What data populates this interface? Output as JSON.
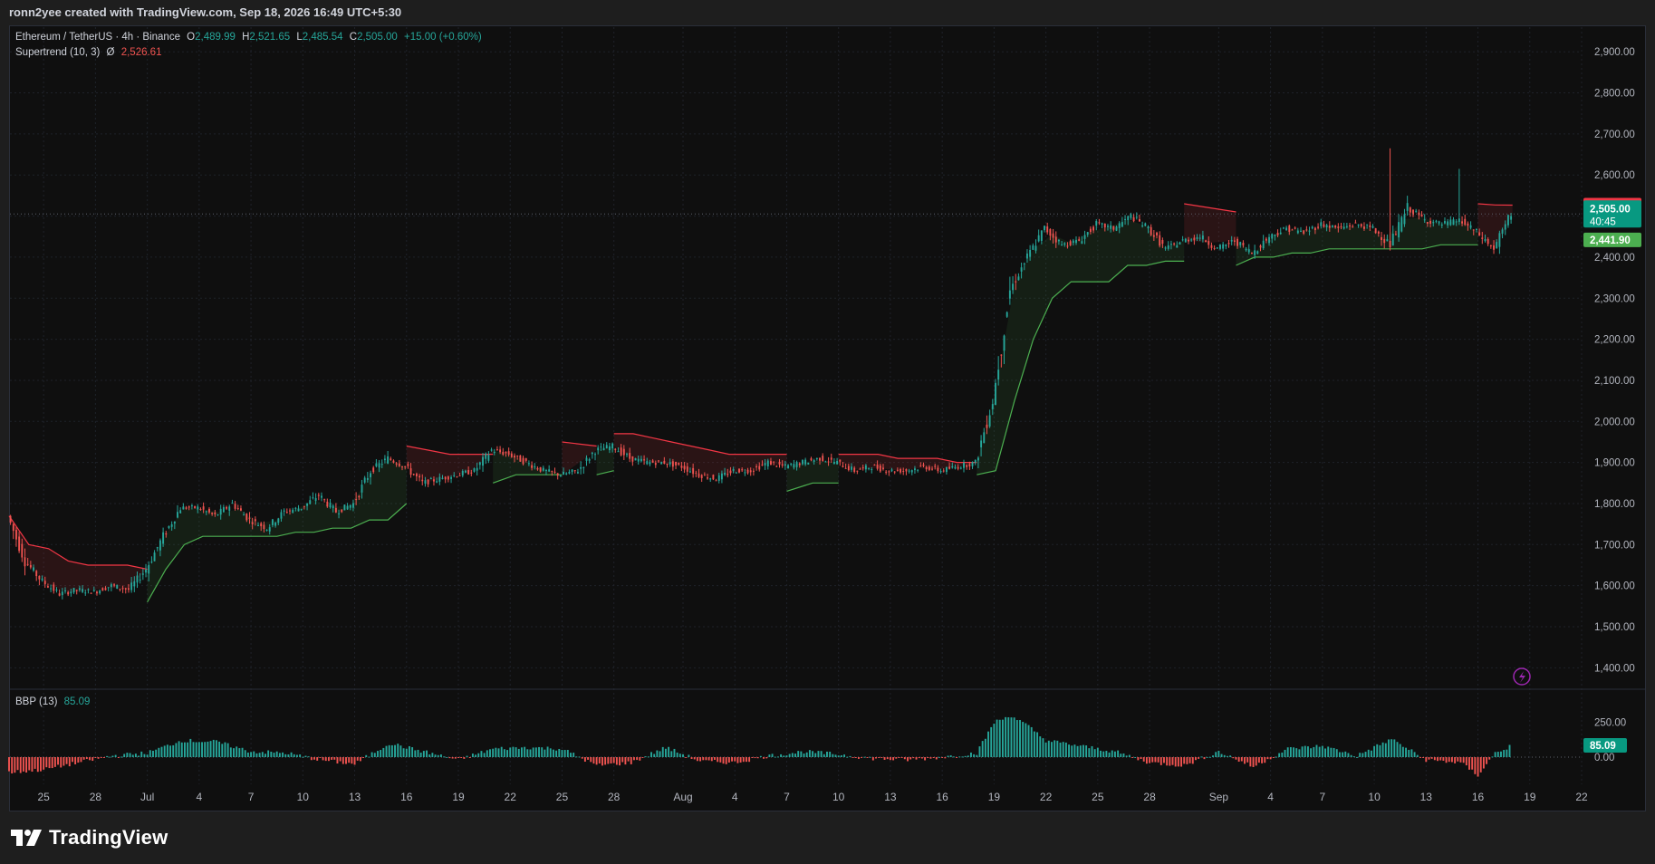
{
  "header": {
    "credit": "ronn2yee created with TradingView.com, Sep 18, 2026 16:49 UTC+5:30"
  },
  "legend": {
    "symbol": "Ethereum / TetherUS · 4h · Binance",
    "o_label": "O",
    "o_value": "2,489.99",
    "h_label": "H",
    "h_value": "2,521.65",
    "l_label": "L",
    "l_value": "2,485.54",
    "c_label": "C",
    "c_value": "2,505.00",
    "change": "+15.00 (+0.60%)",
    "indicator_name": "Supertrend (10, 3)",
    "indicator_sep": "Ø",
    "indicator_value": "2,526.61"
  },
  "bbp_legend": {
    "name": "BBP (13)",
    "value": "85.09"
  },
  "price_labels": {
    "supertrend": "2,526.61",
    "last": "2,505.00",
    "countdown": "40:45",
    "support": "2,441.90",
    "bbp_last": "85.09"
  },
  "brand": {
    "name": "TradingView"
  },
  "colors": {
    "up": "#26a69a",
    "down": "#ef5350",
    "up_line": "#4caf50",
    "down_line": "#f23645",
    "background": "#0f0f0f",
    "grid": "#1f2229",
    "text": "#b2b5be",
    "alert_icon": "#9c27b0"
  },
  "chart_data": [
    {
      "type": "candlestick",
      "title": "",
      "timeframe": "4h",
      "y_axis": {
        "ticks": [
          1400,
          1500,
          1600,
          1700,
          1800,
          1900,
          2000,
          2100,
          2200,
          2300,
          2400,
          2500,
          2600,
          2700,
          2800,
          2900
        ],
        "tick_labels": [
          "1,400.00",
          "1,500.00",
          "1,600.00",
          "1,700.00",
          "1,800.00",
          "1,900.00",
          "2,000.00",
          "2,100.00",
          "2,200.00",
          "2,300.00",
          "2,400.00",
          "2,500.00",
          "2,600.00",
          "2,700.00",
          "2,800.00",
          "2,900.00"
        ],
        "range": [
          1350,
          2960
        ]
      },
      "x_axis": {
        "tick_labels": [
          "25",
          "28",
          "Jul",
          "4",
          "7",
          "10",
          "13",
          "16",
          "19",
          "22",
          "25",
          "28",
          "Aug",
          "4",
          "7",
          "10",
          "13",
          "16",
          "19",
          "22",
          "25",
          "28",
          "Sep",
          "4",
          "7",
          "10",
          "13",
          "16",
          "19",
          "22"
        ],
        "ticks": [
          "2026-06-25",
          "2026-06-28",
          "2026-07-01",
          "2026-07-04",
          "2026-07-07",
          "2026-07-10",
          "2026-07-13",
          "2026-07-16",
          "2026-07-19",
          "2026-07-22",
          "2026-07-25",
          "2026-07-28",
          "2026-08-01",
          "2026-08-04",
          "2026-08-07",
          "2026-08-10",
          "2026-08-13",
          "2026-08-16",
          "2026-08-19",
          "2026-08-22",
          "2026-08-25",
          "2026-08-28",
          "2026-09-01",
          "2026-09-04",
          "2026-09-07",
          "2026-09-10",
          "2026-09-13",
          "2026-09-16",
          "2026-09-19",
          "2026-09-22"
        ],
        "range": [
          "2026-06-23",
          "2026-09-22"
        ]
      },
      "grid": true,
      "price_path": {
        "x": [
          "2026-06-23",
          "2026-06-24",
          "2026-06-25",
          "2026-06-26",
          "2026-06-27",
          "2026-06-28",
          "2026-06-29",
          "2026-06-30",
          "2026-07-01",
          "2026-07-02",
          "2026-07-03",
          "2026-07-04",
          "2026-07-05",
          "2026-07-06",
          "2026-07-07",
          "2026-07-08",
          "2026-07-09",
          "2026-07-10",
          "2026-07-11",
          "2026-07-12",
          "2026-07-13",
          "2026-07-14",
          "2026-07-15",
          "2026-07-16",
          "2026-07-17",
          "2026-07-18",
          "2026-07-19",
          "2026-07-20",
          "2026-07-21",
          "2026-07-22",
          "2026-07-23",
          "2026-07-24",
          "2026-07-25",
          "2026-07-26",
          "2026-07-27",
          "2026-07-28",
          "2026-07-29",
          "2026-07-30",
          "2026-07-31",
          "2026-08-01",
          "2026-08-02",
          "2026-08-03",
          "2026-08-04",
          "2026-08-05",
          "2026-08-06",
          "2026-08-07",
          "2026-08-08",
          "2026-08-09",
          "2026-08-10",
          "2026-08-11",
          "2026-08-12",
          "2026-08-13",
          "2026-08-14",
          "2026-08-15",
          "2026-08-16",
          "2026-08-17",
          "2026-08-18",
          "2026-08-19",
          "2026-08-20",
          "2026-08-21",
          "2026-08-22",
          "2026-08-23",
          "2026-08-24",
          "2026-08-25",
          "2026-08-26",
          "2026-08-27",
          "2026-08-28",
          "2026-08-29",
          "2026-08-30",
          "2026-08-31",
          "2026-09-01",
          "2026-09-02",
          "2026-09-03",
          "2026-09-04",
          "2026-09-05",
          "2026-09-06",
          "2026-09-07",
          "2026-09-08",
          "2026-09-09",
          "2026-09-10",
          "2026-09-11",
          "2026-09-12",
          "2026-09-13",
          "2026-09-14",
          "2026-09-15",
          "2026-09-16",
          "2026-09-17",
          "2026-09-18"
        ],
        "close": [
          1770,
          1660,
          1610,
          1580,
          1590,
          1585,
          1600,
          1590,
          1640,
          1720,
          1790,
          1790,
          1770,
          1800,
          1760,
          1740,
          1780,
          1790,
          1820,
          1780,
          1800,
          1880,
          1910,
          1890,
          1850,
          1860,
          1870,
          1880,
          1930,
          1920,
          1900,
          1880,
          1870,
          1880,
          1930,
          1940,
          1910,
          1900,
          1900,
          1890,
          1870,
          1860,
          1880,
          1880,
          1900,
          1890,
          1900,
          1910,
          1900,
          1880,
          1890,
          1880,
          1880,
          1890,
          1880,
          1890,
          1900,
          2050,
          2320,
          2400,
          2470,
          2430,
          2440,
          2480,
          2470,
          2500,
          2470,
          2420,
          2440,
          2450,
          2420,
          2440,
          2410,
          2450,
          2470,
          2460,
          2480,
          2470,
          2480,
          2470,
          2430,
          2520,
          2490,
          2480,
          2490,
          2460,
          2420,
          2505
        ]
      },
      "supertrend": {
        "current_resistance": 2526.61,
        "current_support": 2441.9,
        "segments": [
          {
            "trend": "down",
            "from": "2026-06-23",
            "to": "2026-07-01",
            "levels": [
              1770,
              1700,
              1690,
              1660,
              1650,
              1650,
              1650,
              1640
            ]
          },
          {
            "trend": "up",
            "from": "2026-07-01",
            "to": "2026-07-16",
            "levels": [
              1560,
              1640,
              1700,
              1720,
              1720,
              1720,
              1720,
              1720,
              1730,
              1730,
              1740,
              1740,
              1760,
              1760,
              1800
            ]
          },
          {
            "trend": "down",
            "from": "2026-07-16",
            "to": "2026-07-21",
            "levels": [
              1940,
              1930,
              1920,
              1920,
              1920
            ]
          },
          {
            "trend": "up",
            "from": "2026-07-21",
            "to": "2026-07-25",
            "levels": [
              1850,
              1870,
              1870,
              1870
            ]
          },
          {
            "trend": "down",
            "from": "2026-07-25",
            "to": "2026-07-27",
            "levels": [
              1950,
              1940
            ]
          },
          {
            "trend": "up",
            "from": "2026-07-27",
            "to": "2026-07-28",
            "levels": [
              1870,
              1880
            ]
          },
          {
            "trend": "down",
            "from": "2026-07-28",
            "to": "2026-08-07",
            "levels": [
              1970,
              1970,
              1960,
              1950,
              1940,
              1930,
              1920,
              1920,
              1920,
              1920
            ]
          },
          {
            "trend": "up",
            "from": "2026-08-07",
            "to": "2026-08-10",
            "levels": [
              1830,
              1850,
              1850
            ]
          },
          {
            "trend": "down",
            "from": "2026-08-10",
            "to": "2026-08-18",
            "levels": [
              1920,
              1920,
              1920,
              1910,
              1910,
              1910,
              1900,
              1900
            ]
          },
          {
            "trend": "up",
            "from": "2026-08-18",
            "to": "2026-08-30",
            "levels": [
              1870,
              1880,
              2050,
              2200,
              2300,
              2340,
              2340,
              2340,
              2380,
              2380,
              2390,
              2390
            ]
          },
          {
            "trend": "down",
            "from": "2026-08-30",
            "to": "2026-09-02",
            "levels": [
              2530,
              2520,
              2510
            ]
          },
          {
            "trend": "up",
            "from": "2026-09-02",
            "to": "2026-09-16",
            "levels": [
              2380,
              2400,
              2400,
              2410,
              2410,
              2420,
              2420,
              2420,
              2420,
              2420,
              2420,
              2430,
              2430,
              2430
            ]
          },
          {
            "trend": "down",
            "from": "2026-09-16",
            "to": "2026-09-18",
            "levels": [
              2530,
              2527,
              2526.61
            ]
          }
        ]
      },
      "last_price": 2505.0,
      "price_high_spikes": [
        {
          "x": "2026-09-11",
          "high": 2665
        },
        {
          "x": "2026-09-15",
          "high": 2615
        }
      ]
    },
    {
      "type": "bar",
      "title": "",
      "series_name": "BBP (13)",
      "y_axis": {
        "tick_labels": [
          "0.00",
          "250.00"
        ],
        "ticks": [
          0,
          250
        ],
        "range": [
          -180,
          430
        ]
      },
      "last_value": 85.09,
      "x": [
        "2026-06-23",
        "2026-06-25",
        "2026-06-27",
        "2026-06-29",
        "2026-07-01",
        "2026-07-03",
        "2026-07-05",
        "2026-07-07",
        "2026-07-09",
        "2026-07-11",
        "2026-07-13",
        "2026-07-15",
        "2026-07-17",
        "2026-07-19",
        "2026-07-21",
        "2026-07-23",
        "2026-07-25",
        "2026-07-27",
        "2026-07-29",
        "2026-07-31",
        "2026-08-02",
        "2026-08-04",
        "2026-08-06",
        "2026-08-08",
        "2026-08-10",
        "2026-08-12",
        "2026-08-14",
        "2026-08-16",
        "2026-08-18",
        "2026-08-19",
        "2026-08-20",
        "2026-08-21",
        "2026-08-22",
        "2026-08-24",
        "2026-08-26",
        "2026-08-28",
        "2026-08-30",
        "2026-09-01",
        "2026-09-03",
        "2026-09-05",
        "2026-09-07",
        "2026-09-09",
        "2026-09-11",
        "2026-09-13",
        "2026-09-15",
        "2026-09-16",
        "2026-09-17",
        "2026-09-18"
      ],
      "values": [
        -110,
        -90,
        -40,
        10,
        30,
        120,
        110,
        40,
        30,
        -20,
        -50,
        100,
        40,
        -20,
        60,
        70,
        60,
        -60,
        -40,
        70,
        -30,
        -40,
        10,
        40,
        20,
        -10,
        -20,
        0,
        30,
        250,
        300,
        220,
        120,
        80,
        40,
        -40,
        -60,
        40,
        -70,
        60,
        80,
        10,
        130,
        -20,
        -40,
        -130,
        30,
        85.09
      ]
    }
  ]
}
